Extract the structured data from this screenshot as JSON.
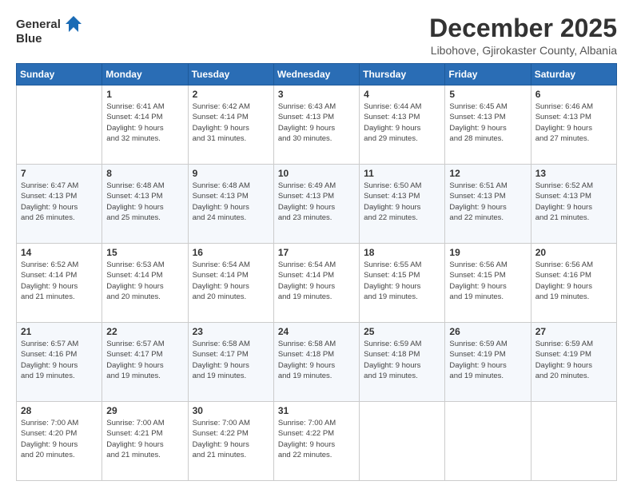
{
  "header": {
    "logo_line1": "General",
    "logo_line2": "Blue",
    "month": "December 2025",
    "location": "Libohove, Gjirokaster County, Albania"
  },
  "days_of_week": [
    "Sunday",
    "Monday",
    "Tuesday",
    "Wednesday",
    "Thursday",
    "Friday",
    "Saturday"
  ],
  "weeks": [
    [
      {
        "day": "",
        "info": ""
      },
      {
        "day": "1",
        "info": "Sunrise: 6:41 AM\nSunset: 4:14 PM\nDaylight: 9 hours\nand 32 minutes."
      },
      {
        "day": "2",
        "info": "Sunrise: 6:42 AM\nSunset: 4:14 PM\nDaylight: 9 hours\nand 31 minutes."
      },
      {
        "day": "3",
        "info": "Sunrise: 6:43 AM\nSunset: 4:13 PM\nDaylight: 9 hours\nand 30 minutes."
      },
      {
        "day": "4",
        "info": "Sunrise: 6:44 AM\nSunset: 4:13 PM\nDaylight: 9 hours\nand 29 minutes."
      },
      {
        "day": "5",
        "info": "Sunrise: 6:45 AM\nSunset: 4:13 PM\nDaylight: 9 hours\nand 28 minutes."
      },
      {
        "day": "6",
        "info": "Sunrise: 6:46 AM\nSunset: 4:13 PM\nDaylight: 9 hours\nand 27 minutes."
      }
    ],
    [
      {
        "day": "7",
        "info": "Sunrise: 6:47 AM\nSunset: 4:13 PM\nDaylight: 9 hours\nand 26 minutes."
      },
      {
        "day": "8",
        "info": "Sunrise: 6:48 AM\nSunset: 4:13 PM\nDaylight: 9 hours\nand 25 minutes."
      },
      {
        "day": "9",
        "info": "Sunrise: 6:48 AM\nSunset: 4:13 PM\nDaylight: 9 hours\nand 24 minutes."
      },
      {
        "day": "10",
        "info": "Sunrise: 6:49 AM\nSunset: 4:13 PM\nDaylight: 9 hours\nand 23 minutes."
      },
      {
        "day": "11",
        "info": "Sunrise: 6:50 AM\nSunset: 4:13 PM\nDaylight: 9 hours\nand 22 minutes."
      },
      {
        "day": "12",
        "info": "Sunrise: 6:51 AM\nSunset: 4:13 PM\nDaylight: 9 hours\nand 22 minutes."
      },
      {
        "day": "13",
        "info": "Sunrise: 6:52 AM\nSunset: 4:13 PM\nDaylight: 9 hours\nand 21 minutes."
      }
    ],
    [
      {
        "day": "14",
        "info": "Sunrise: 6:52 AM\nSunset: 4:14 PM\nDaylight: 9 hours\nand 21 minutes."
      },
      {
        "day": "15",
        "info": "Sunrise: 6:53 AM\nSunset: 4:14 PM\nDaylight: 9 hours\nand 20 minutes."
      },
      {
        "day": "16",
        "info": "Sunrise: 6:54 AM\nSunset: 4:14 PM\nDaylight: 9 hours\nand 20 minutes."
      },
      {
        "day": "17",
        "info": "Sunrise: 6:54 AM\nSunset: 4:14 PM\nDaylight: 9 hours\nand 19 minutes."
      },
      {
        "day": "18",
        "info": "Sunrise: 6:55 AM\nSunset: 4:15 PM\nDaylight: 9 hours\nand 19 minutes."
      },
      {
        "day": "19",
        "info": "Sunrise: 6:56 AM\nSunset: 4:15 PM\nDaylight: 9 hours\nand 19 minutes."
      },
      {
        "day": "20",
        "info": "Sunrise: 6:56 AM\nSunset: 4:16 PM\nDaylight: 9 hours\nand 19 minutes."
      }
    ],
    [
      {
        "day": "21",
        "info": "Sunrise: 6:57 AM\nSunset: 4:16 PM\nDaylight: 9 hours\nand 19 minutes."
      },
      {
        "day": "22",
        "info": "Sunrise: 6:57 AM\nSunset: 4:17 PM\nDaylight: 9 hours\nand 19 minutes."
      },
      {
        "day": "23",
        "info": "Sunrise: 6:58 AM\nSunset: 4:17 PM\nDaylight: 9 hours\nand 19 minutes."
      },
      {
        "day": "24",
        "info": "Sunrise: 6:58 AM\nSunset: 4:18 PM\nDaylight: 9 hours\nand 19 minutes."
      },
      {
        "day": "25",
        "info": "Sunrise: 6:59 AM\nSunset: 4:18 PM\nDaylight: 9 hours\nand 19 minutes."
      },
      {
        "day": "26",
        "info": "Sunrise: 6:59 AM\nSunset: 4:19 PM\nDaylight: 9 hours\nand 19 minutes."
      },
      {
        "day": "27",
        "info": "Sunrise: 6:59 AM\nSunset: 4:19 PM\nDaylight: 9 hours\nand 20 minutes."
      }
    ],
    [
      {
        "day": "28",
        "info": "Sunrise: 7:00 AM\nSunset: 4:20 PM\nDaylight: 9 hours\nand 20 minutes."
      },
      {
        "day": "29",
        "info": "Sunrise: 7:00 AM\nSunset: 4:21 PM\nDaylight: 9 hours\nand 21 minutes."
      },
      {
        "day": "30",
        "info": "Sunrise: 7:00 AM\nSunset: 4:22 PM\nDaylight: 9 hours\nand 21 minutes."
      },
      {
        "day": "31",
        "info": "Sunrise: 7:00 AM\nSunset: 4:22 PM\nDaylight: 9 hours\nand 22 minutes."
      },
      {
        "day": "",
        "info": ""
      },
      {
        "day": "",
        "info": ""
      },
      {
        "day": "",
        "info": ""
      }
    ]
  ]
}
